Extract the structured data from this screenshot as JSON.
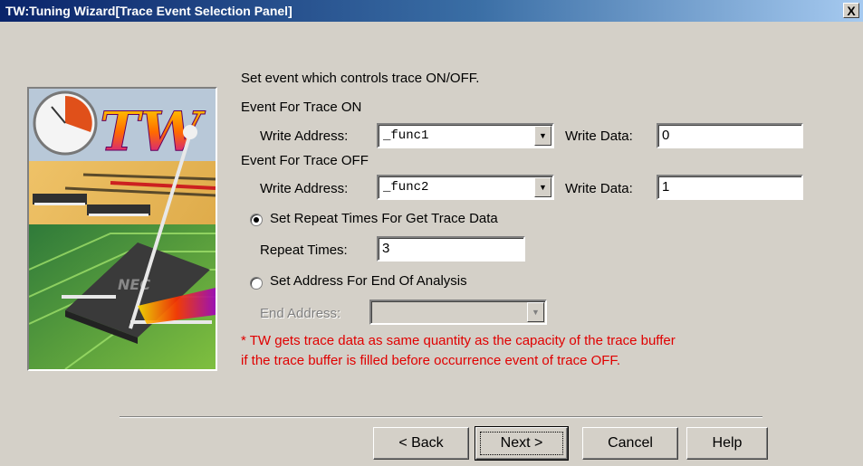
{
  "window": {
    "title": "TW:Tuning Wizard[Trace Event Selection Panel]",
    "close_glyph": "X"
  },
  "panel": {
    "instruction": "Set event which controls trace ON/OFF.",
    "trace_on": {
      "heading": "Event For Trace ON",
      "write_address_label": "Write Address:",
      "write_address_value": "_func1",
      "write_data_label": "Write Data:",
      "write_data_value": "0"
    },
    "trace_off": {
      "heading": "Event For Trace OFF",
      "write_address_label": "Write Address:",
      "write_address_value": "_func2",
      "write_data_label": "Write Data:",
      "write_data_value": "1"
    },
    "repeat_option": {
      "label": "Set Repeat Times For Get Trace Data",
      "selected": true,
      "repeat_times_label": "Repeat Times:",
      "repeat_times_value": "3"
    },
    "end_option": {
      "label": "Set Address For End Of Analysis",
      "selected": false,
      "end_address_label": "End Address:",
      "end_address_value": ""
    },
    "note_line1": "* TW gets trace data as same quantity as the capacity of the trace buffer",
    "note_line2": "if the trace buffer is filled before occurrence event of trace OFF.",
    "logo_text": "TW",
    "chip_text": "NEC"
  },
  "buttons": {
    "back": "< Back",
    "next": "Next >",
    "cancel": "Cancel",
    "help": "Help"
  },
  "colors": {
    "note": "#e00000",
    "title_gradient_start": "#0a246a",
    "face": "#d4d0c8"
  }
}
